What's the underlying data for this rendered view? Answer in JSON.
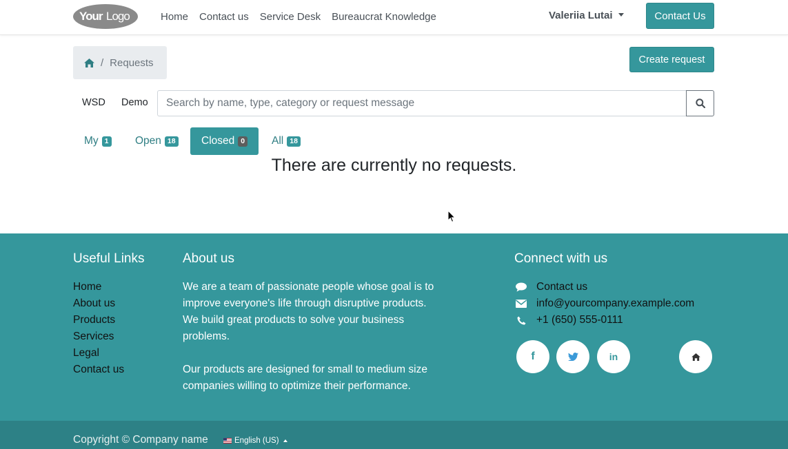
{
  "header": {
    "logo_text": "YourLogo",
    "nav": [
      "Home",
      "Contact us",
      "Service Desk",
      "Bureaucrat Knowledge"
    ],
    "user_name": "Valeriia Lutai",
    "contact_button": "Contact Us"
  },
  "breadcrumb": {
    "home_icon": "home-icon",
    "separator": "/",
    "current": "Requests"
  },
  "actions": {
    "create_request": "Create request"
  },
  "filters": {
    "first": "WSD",
    "second": "Demo"
  },
  "search": {
    "placeholder": "Search by name, type, category or request message",
    "icon": "search-icon"
  },
  "tabs": [
    {
      "label": "My",
      "count": "1"
    },
    {
      "label": "Open",
      "count": "18"
    },
    {
      "label": "Closed",
      "count": "0"
    },
    {
      "label": "All",
      "count": "18"
    }
  ],
  "empty_message": "There are currently no requests.",
  "footer": {
    "useful_links_title": "Useful Links",
    "useful_links": [
      "Home",
      "About us",
      "Products",
      "Services",
      "Legal",
      "Contact us"
    ],
    "about_title": "About us",
    "about_p1": "We are a team of passionate people whose goal is to improve everyone's life through disruptive products. We build great products to solve your business problems.",
    "about_p2": "Our products are designed for small to medium size companies willing to optimize their performance.",
    "connect_title": "Connect with us",
    "connect": [
      {
        "icon": "chat-icon",
        "text": "Contact us"
      },
      {
        "icon": "envelope-icon",
        "text": "info@yourcompany.example.com"
      },
      {
        "icon": "phone-icon",
        "text": "+1 (650) 555-0111"
      }
    ],
    "social": {
      "facebook": "f",
      "twitter": "twitter-icon",
      "linkedin": "in",
      "home": "home-icon"
    }
  },
  "copyright": {
    "text": "Copyright © Company name",
    "language": "English (US)"
  },
  "colors": {
    "accent": "#35979c",
    "footer_dark": "#2d8186"
  }
}
